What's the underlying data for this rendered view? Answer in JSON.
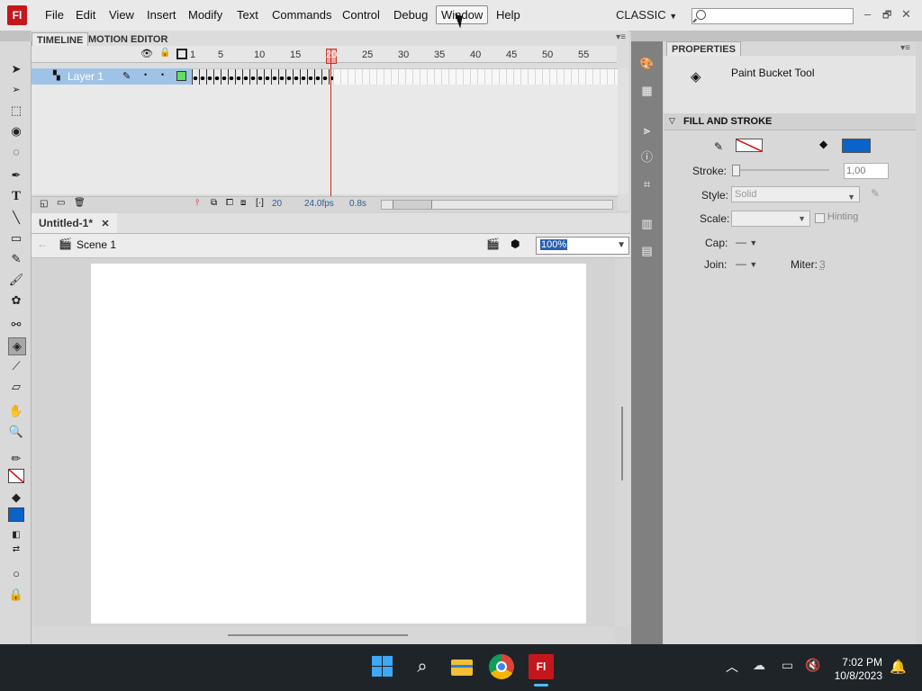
{
  "app": {
    "logo_text": "Fl",
    "workspace": "CLASSIC"
  },
  "menu": [
    "File",
    "Edit",
    "View",
    "Insert",
    "Modify",
    "Text",
    "Commands",
    "Control",
    "Debug",
    "Window",
    "Help"
  ],
  "window_buttons": [
    "–",
    "🗗",
    "✕"
  ],
  "timeline": {
    "tabs": [
      "TIMELINE",
      "MOTION EDITOR"
    ],
    "frame_numbers": [
      "1",
      "5",
      "10",
      "15",
      "20",
      "25",
      "30",
      "35",
      "40",
      "45",
      "50",
      "55"
    ],
    "layer_name": "Layer 1",
    "current_frame": "20",
    "fps": "24.0fps",
    "time": "0.8s"
  },
  "document": {
    "tab": "Untitled-1*",
    "scene": "Scene 1",
    "zoom": "100%"
  },
  "properties": {
    "tab": "PROPERTIES",
    "tool_name": "Paint Bucket Tool",
    "section": "FILL AND STROKE",
    "stroke_label": "Stroke:",
    "stroke_value": "1,00",
    "style_label": "Style:",
    "style_value": "Solid",
    "scale_label": "Scale:",
    "hinting_label": "Hinting",
    "cap_label": "Cap:",
    "join_label": "Join:",
    "miter_label": "Miter:",
    "miter_value": "3",
    "fill_color": "#0a63c9"
  },
  "taskbar": {
    "time": "7:02 PM",
    "date": "10/8/2023"
  },
  "colors": {
    "accent": "#c4171d",
    "selection": "#9fc3e6",
    "playhead": "#d9231c"
  }
}
